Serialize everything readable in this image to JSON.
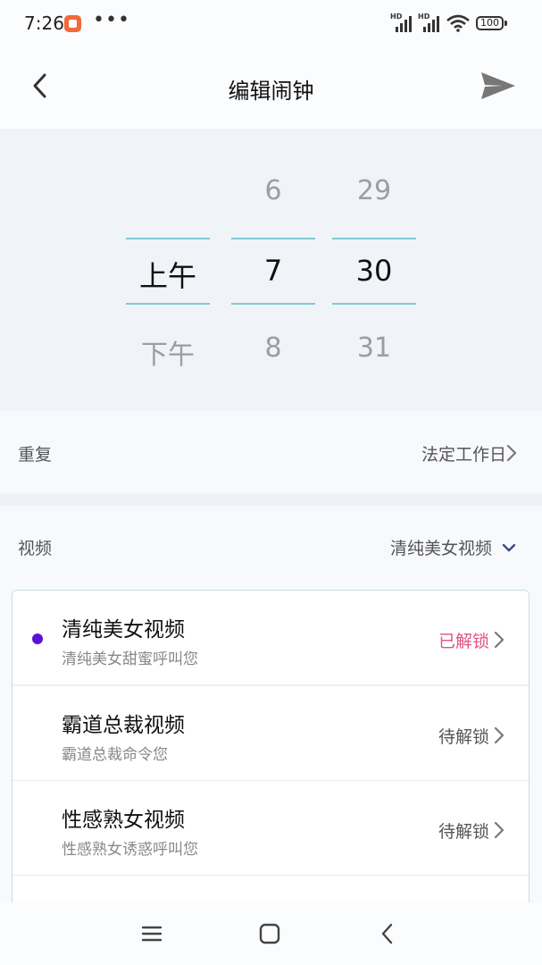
{
  "status_bar": {
    "time": "7:26",
    "more": "•••",
    "signal_badge": "HD",
    "battery": "100"
  },
  "header": {
    "title": "编辑闹钟",
    "back_icon": "chevron-left-icon",
    "send_icon": "send-icon"
  },
  "picker": {
    "period": {
      "above": "",
      "selected": "上午",
      "below": "下午"
    },
    "hour": {
      "above": "6",
      "selected": "7",
      "below": "8"
    },
    "minute": {
      "above": "29",
      "selected": "30",
      "below": "31"
    }
  },
  "repeat": {
    "label": "重复",
    "value": "法定工作日"
  },
  "video": {
    "label": "视频",
    "value": "清纯美女视频"
  },
  "video_options": [
    {
      "title": "清纯美女视频",
      "subtitle": "清纯美女甜蜜呼叫您",
      "status": "已解锁",
      "selected": true
    },
    {
      "title": "霸道总裁视频",
      "subtitle": "霸道总裁命令您",
      "status": "待解锁",
      "selected": false
    },
    {
      "title": "性感熟女视频",
      "subtitle": "性感熟女诱惑呼叫您",
      "status": "待解锁",
      "selected": false
    },
    {
      "title": "",
      "subtitle": "",
      "status": "",
      "selected": false
    }
  ],
  "colors": {
    "accent_line": "#7fc9d2",
    "unlocked": "#e0537f",
    "selected_dot": "#5a12d8",
    "dropdown_chevron": "#3a4a8a"
  },
  "navbar": {
    "menu_icon": "menu-icon",
    "home_icon": "home-icon",
    "back_icon": "back-icon"
  }
}
